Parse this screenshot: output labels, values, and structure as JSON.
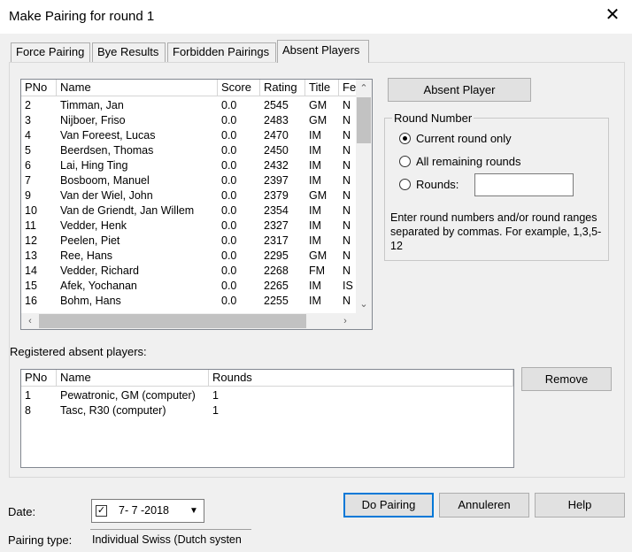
{
  "window": {
    "title": "Make Pairing for round 1",
    "close_glyph": "✕"
  },
  "tabs": [
    {
      "label": "Force Pairing",
      "active": false
    },
    {
      "label": "Bye Results",
      "active": false
    },
    {
      "label": "Forbidden Pairings",
      "active": false
    },
    {
      "label": "Absent Players",
      "active": true
    }
  ],
  "players_list": {
    "columns": [
      "PNo",
      "Name",
      "Score",
      "Rating",
      "Title",
      "Fe"
    ],
    "rows": [
      [
        "2",
        "Timman, Jan",
        "0.0",
        "2545",
        "GM",
        "N"
      ],
      [
        "3",
        "Nijboer, Friso",
        "0.0",
        "2483",
        "GM",
        "N"
      ],
      [
        "4",
        "Van Foreest, Lucas",
        "0.0",
        "2470",
        "IM",
        "N"
      ],
      [
        "5",
        "Beerdsen, Thomas",
        "0.0",
        "2450",
        "IM",
        "N"
      ],
      [
        "6",
        "Lai, Hing Ting",
        "0.0",
        "2432",
        "IM",
        "N"
      ],
      [
        "7",
        "Bosboom, Manuel",
        "0.0",
        "2397",
        "IM",
        "N"
      ],
      [
        "9",
        "Van der Wiel, John",
        "0.0",
        "2379",
        "GM",
        "N"
      ],
      [
        "10",
        "Van de Griendt, Jan Willem",
        "0.0",
        "2354",
        "IM",
        "N"
      ],
      [
        "11",
        "Vedder, Henk",
        "0.0",
        "2327",
        "IM",
        "N"
      ],
      [
        "12",
        "Peelen, Piet",
        "0.0",
        "2317",
        "IM",
        "N"
      ],
      [
        "13",
        "Ree, Hans",
        "0.0",
        "2295",
        "GM",
        "N"
      ],
      [
        "14",
        "Vedder, Richard",
        "0.0",
        "2268",
        "FM",
        "N"
      ],
      [
        "15",
        "Afek, Yochanan",
        "0.0",
        "2265",
        "IM",
        "IS"
      ],
      [
        "16",
        "Bohm, Hans",
        "0.0",
        "2255",
        "IM",
        "N"
      ]
    ]
  },
  "absent_player_button": "Absent Player",
  "round_number": {
    "legend": "Round Number",
    "options": [
      {
        "label": "Current round only",
        "selected": true
      },
      {
        "label": "All remaining rounds",
        "selected": false
      },
      {
        "label": "Rounds:",
        "selected": false
      }
    ],
    "rounds_input_value": "",
    "help_text": "Enter round numbers and/or round ranges separated by commas. For example, 1,3,5-12"
  },
  "registered": {
    "label": "Registered absent players:",
    "columns": [
      "PNo",
      "Name",
      "Rounds"
    ],
    "rows": [
      [
        "1",
        "Pewatronic, GM (computer)",
        "1"
      ],
      [
        "8",
        "Tasc, R30 (computer)",
        "1"
      ]
    ]
  },
  "remove_button": "Remove",
  "footer": {
    "date_label": "Date:",
    "date_value": "7- 7 -2018",
    "date_checked": true,
    "pairing_type_label": "Pairing type:",
    "pairing_type_value": "Individual Swiss (Dutch systen",
    "do_pairing_button": "Do Pairing",
    "cancel_button": "Annuleren",
    "help_button": "Help"
  }
}
